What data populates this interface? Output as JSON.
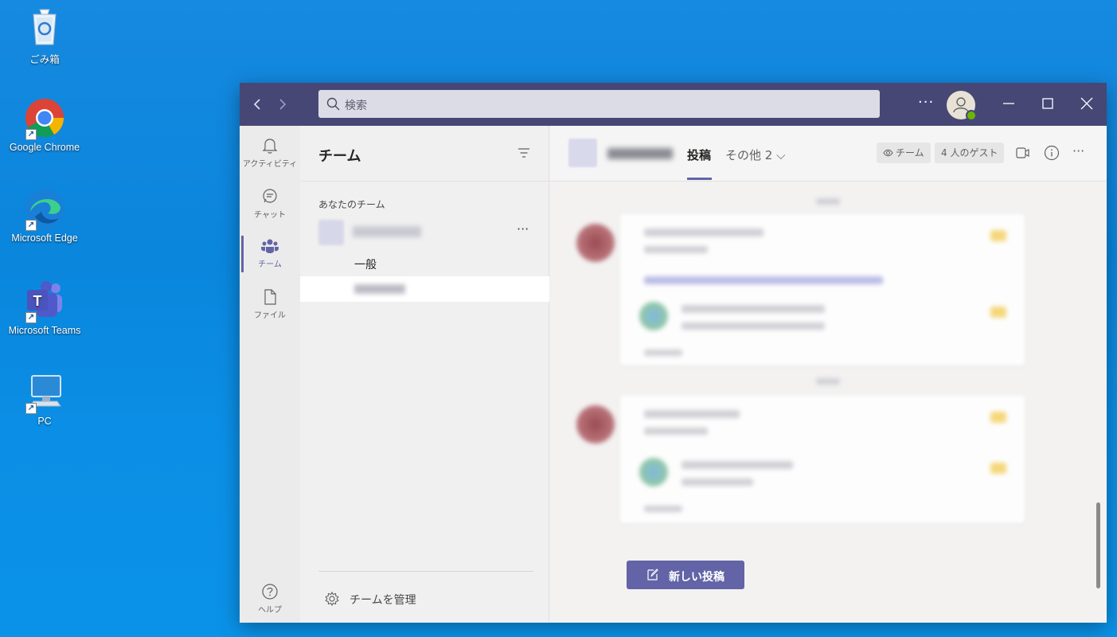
{
  "desktop": {
    "icons": [
      {
        "label": "ごみ箱"
      },
      {
        "label": "Google Chrome"
      },
      {
        "label": "Microsoft Edge"
      },
      {
        "label": "Microsoft Teams"
      },
      {
        "label": "PC"
      }
    ]
  },
  "titlebar": {
    "search_placeholder": "検索",
    "more": "···"
  },
  "rail": {
    "items": [
      {
        "label": "アクティビティ",
        "icon": "bell-icon"
      },
      {
        "label": "チャット",
        "icon": "chat-icon"
      },
      {
        "label": "チーム",
        "icon": "teams-icon"
      },
      {
        "label": "ファイル",
        "icon": "file-icon"
      },
      {
        "label": "ヘルプ",
        "icon": "help-icon"
      }
    ]
  },
  "teams_pane": {
    "title": "チーム",
    "section_label": "あなたのチーム",
    "team_more": "···",
    "channels": [
      {
        "label": "一般"
      }
    ],
    "manage_label": "チームを管理"
  },
  "channel_pane": {
    "tabs": [
      {
        "label": "投稿"
      },
      {
        "label": "その他 2 ⌵"
      }
    ],
    "team_chip": "チーム",
    "guests_chip": "4 人のゲスト",
    "new_post_label": "新しい投稿"
  },
  "colors": {
    "titlebar": "#464775",
    "accent": "#6264a7",
    "desktop": "#0a86dc"
  }
}
